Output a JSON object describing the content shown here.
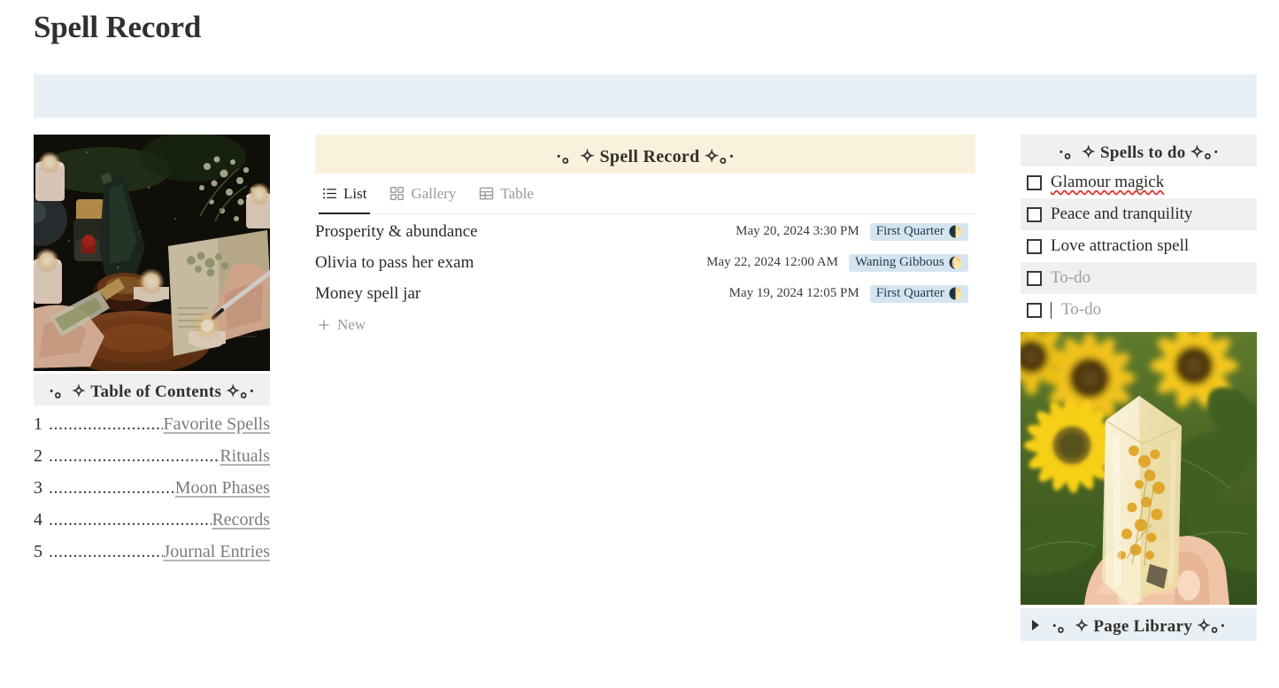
{
  "page": {
    "title": "Spell Record"
  },
  "toc": {
    "header": "·。✧ Table of Contents ✧。·",
    "entries": [
      {
        "num": "1",
        "leader": "................................",
        "label": "Favorite Spells"
      },
      {
        "num": "2",
        "leader": "......................................................",
        "label": "Rituals"
      },
      {
        "num": "3",
        "leader": "........................................",
        "label": "Moon Phases"
      },
      {
        "num": "4",
        "leader": ".................................................",
        "label": "Records"
      },
      {
        "num": "5",
        "leader": "................................",
        "label": "Journal Entries"
      }
    ]
  },
  "database": {
    "header": "·。✧ Spell Record ✧。·",
    "tabs": [
      {
        "label": "List",
        "icon": "list-icon",
        "active": true
      },
      {
        "label": "Gallery",
        "icon": "gallery-grid-icon",
        "active": false
      },
      {
        "label": "Table",
        "icon": "table-grid-icon",
        "active": false
      }
    ],
    "rows": [
      {
        "title": "Prosperity & abundance",
        "date": "May 20, 2024 3:30 PM",
        "moon_phase": "First Quarter",
        "moon_glyph": "🌓"
      },
      {
        "title": "Olivia to pass her exam",
        "date": "May 22, 2024 12:00 AM",
        "moon_phase": "Waning Gibbous",
        "moon_glyph": "🌔"
      },
      {
        "title": "Money spell jar",
        "date": "May 19, 2024 12:05 PM",
        "moon_phase": "First Quarter",
        "moon_glyph": "🌓"
      }
    ],
    "new_label": "New"
  },
  "todo": {
    "header": "·。✧ Spells to do ✧。·",
    "items": [
      {
        "label": "Glamour magick",
        "checked": false,
        "placeholder": false,
        "misspelled": true,
        "caret": false
      },
      {
        "label": "Peace and tranquility",
        "checked": false,
        "placeholder": false,
        "misspelled": false,
        "caret": false
      },
      {
        "label": "Love attraction spell",
        "checked": false,
        "placeholder": false,
        "misspelled": false,
        "caret": false
      },
      {
        "label": "To-do",
        "checked": false,
        "placeholder": true,
        "misspelled": false,
        "caret": false
      },
      {
        "label": "To-do",
        "checked": false,
        "placeholder": true,
        "misspelled": false,
        "caret": true
      }
    ]
  },
  "library": {
    "title": "·。✧ Page Library ✧。·",
    "expanded": false
  },
  "colors": {
    "blue_band": "#e8f0f5",
    "cream_header": "#faf1dd",
    "gray_header": "#f0f0ef",
    "badge_bg": "#d5e5ef",
    "badge_text": "#1f3a52",
    "text": "#32302c",
    "muted": "#9b9995"
  }
}
